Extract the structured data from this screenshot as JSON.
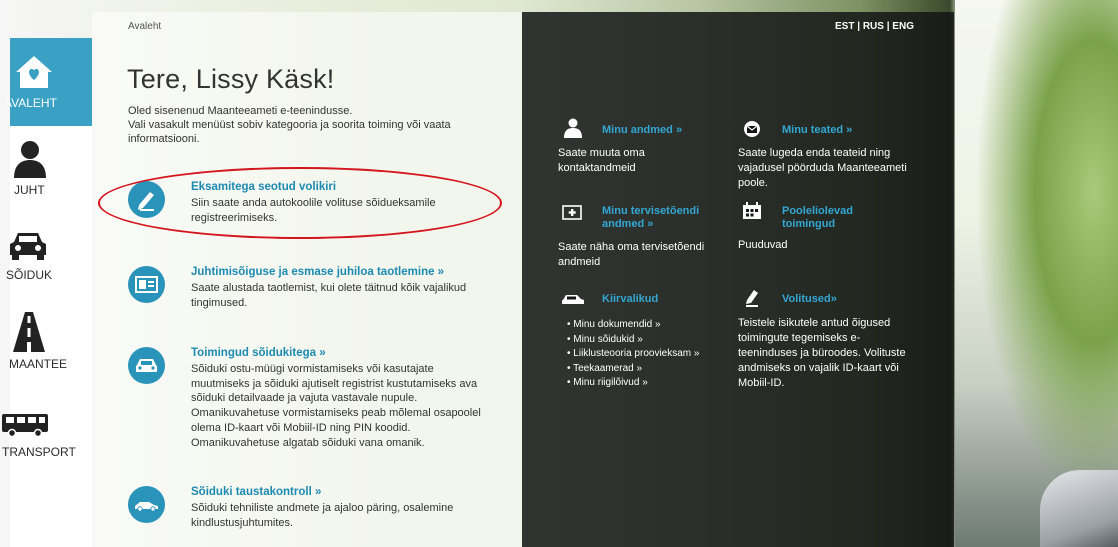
{
  "sidebar": {
    "items": [
      {
        "label": "AVALEHT",
        "icon": "home-icon",
        "active": true
      },
      {
        "label": "JUHT",
        "icon": "driver-icon",
        "active": false
      },
      {
        "label": "SÕIDUK",
        "icon": "car-icon",
        "active": false
      },
      {
        "label": "MAANTEE",
        "icon": "road-icon",
        "active": false
      },
      {
        "label": "TRANSPORT",
        "icon": "bus-icon",
        "active": false
      }
    ]
  },
  "main": {
    "breadcrumb": "Avaleht",
    "greeting": "Tere, Lissy Käsk!",
    "intro_line1": "Oled sisenenud Maanteeameti e-teenindusse.",
    "intro_line2": "Vali vasakult menüüst sobiv kategooria ja soorita toiming või vaata informatsiooni.",
    "entries": [
      {
        "title": "Eksamitega seotud volikiri",
        "desc": "Siin saate anda autokoolile volituse sõidueksamile registreerimiseks.",
        "icon": "pencil-icon"
      },
      {
        "title": "Juhtimisõiguse ja esmase juhiloa taotlemine »",
        "desc": "Saate alustada taotlemist, kui olete täitnud kõik vajalikud tingimused.",
        "icon": "id-card-icon"
      },
      {
        "title": "Toimingud sõidukitega »",
        "desc": "Sõiduki ostu-müügi vormistamiseks või kasutajate muutmiseks ja sõiduki ajutiselt registrist kustutamiseks ava sõiduki detailvaade ja vajuta vastavale nupule. Omanikuvahetuse vormistamiseks peab mõlemal osapoolel olema ID-kaart või Mobiil-ID ning PIN koodid. Omanikuvahetuse algatab sõiduki vana omanik.",
        "icon": "car-icon"
      },
      {
        "title": "Sõiduki taustakontroll »",
        "desc": "Sõiduki tehniliste andmete ja ajaloo päring, osalemine kindlustusjuhtumites.",
        "icon": "car-side-icon"
      }
    ]
  },
  "right": {
    "lang": {
      "est": "EST",
      "rus": "RUS",
      "eng": "ENG",
      "sep": " | "
    },
    "my_data": {
      "title": "Minu andmed »",
      "text": "Saate muuta oma kontaktandmeid"
    },
    "my_messages": {
      "title": "Minu teated »",
      "text": "Saate lugeda enda teateid ning vajadusel pöörduda Maanteeameti poole."
    },
    "my_health": {
      "title_line1": "Minu tervisetõendi",
      "title_line2": "andmed »",
      "text": "Saate näha oma tervisetõendi andmeid"
    },
    "pending": {
      "title_line1": "Pooleliolevad",
      "title_line2": "toimingud",
      "text": "Puuduvad"
    },
    "quick": {
      "title": "Kiirvalikud",
      "items": [
        "Minu dokumendid »",
        "Minu sõidukid »",
        "Liiklusteooria proovieksam »",
        "Teekaamerad »",
        "Minu riigilõivud »"
      ]
    },
    "authorizations": {
      "title": "Volitused»",
      "text": "Teistele isikutele antud õigused toimingute tegemiseks e-teeninduses ja büroodes. Volituste andmiseks on vajalik ID-kaart või Mobiil-ID."
    }
  }
}
